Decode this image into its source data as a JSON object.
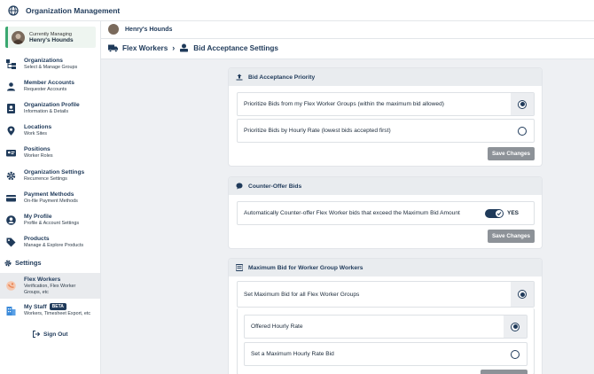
{
  "app": {
    "title": "Organization Management"
  },
  "managing": {
    "label": "Currently Managing",
    "name": "Henry's Hounds"
  },
  "sidebar": {
    "items": [
      {
        "label": "Organizations",
        "desc": "Select & Manage Groups"
      },
      {
        "label": "Member Accounts",
        "desc": "Requester Accounts"
      },
      {
        "label": "Organization Profile",
        "desc": "Information & Details"
      },
      {
        "label": "Locations",
        "desc": "Work Sites"
      },
      {
        "label": "Positions",
        "desc": "Worker Roles"
      },
      {
        "label": "Organization Settings",
        "desc": "Recurrence Settings"
      },
      {
        "label": "Payment Methods",
        "desc": "On-file Payment Methods"
      },
      {
        "label": "My Profile",
        "desc": "Profile & Account Settings"
      },
      {
        "label": "Products",
        "desc": "Manage & Explore Products"
      }
    ],
    "settings_label": "Settings",
    "settings_items": [
      {
        "label": "Flex Workers",
        "desc": "Verification, Flex Worker Groups, etc"
      },
      {
        "label": "My Staff",
        "badge": "BETA",
        "desc": "Workers, Timesheet Export, etc"
      }
    ],
    "sign_out": "Sign Out"
  },
  "header": {
    "org_name": "Henry's Hounds",
    "breadcrumb": [
      "Flex Workers",
      "Bid Acceptance Settings"
    ]
  },
  "bid_priority": {
    "title": "Bid Acceptance Priority",
    "options": [
      "Prioritize Bids from my Flex Worker Groups (within the maximum bid allowed)",
      "Prioritize Bids by Hourly Rate (lowest bids accepted first)"
    ],
    "selected_index": 0,
    "save_label": "Save Changes"
  },
  "counter_offer": {
    "title": "Counter-Offer Bids",
    "option": "Automatically Counter-offer Flex Worker bids that exceed the Maximum Bid Amount",
    "toggle_state": "YES",
    "save_label": "Save Changes"
  },
  "max_bid": {
    "title": "Maximum Bid for Worker Group Workers",
    "option": "Set Maximum Bid for all Flex Worker Groups",
    "sub_options": [
      "Offered Hourly Rate",
      "Set a Maximum Hourly Rate Bid"
    ],
    "sub_selected_index": 0
  },
  "colors": {
    "brand_navy": "#1f3a5a",
    "accent_green": "#3aa870",
    "button_gray": "#8d9298",
    "flex_orange": "#e9895a"
  }
}
